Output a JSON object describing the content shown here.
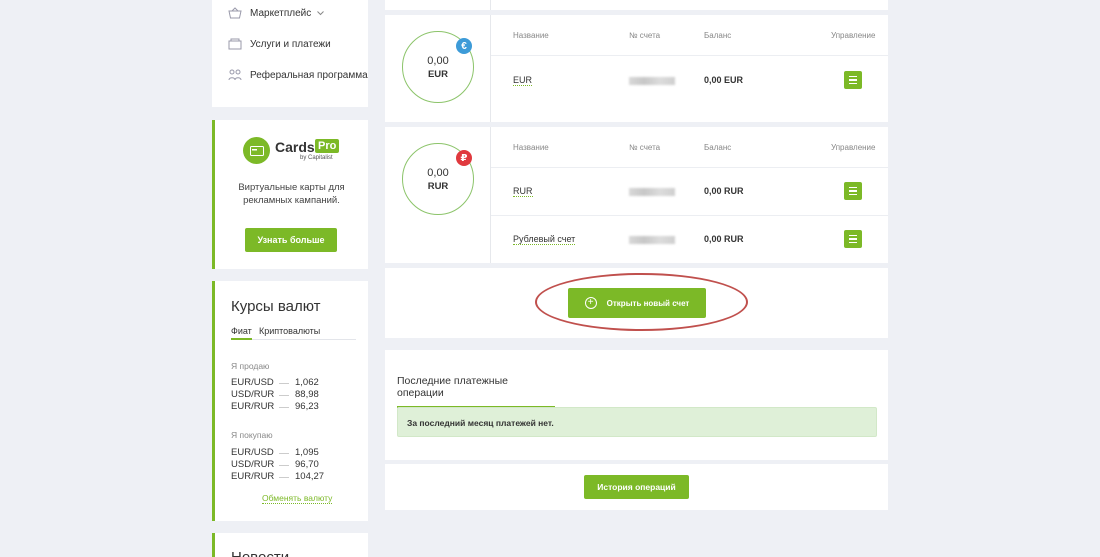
{
  "nav": {
    "items": [
      {
        "label": "Маркетплейс",
        "icon": "basket-icon",
        "has_chevron": true
      },
      {
        "label": "Услуги и платежи",
        "icon": "wallet-icon",
        "has_chevron": false
      },
      {
        "label": "Реферальная программа",
        "icon": "referral-icon",
        "has_chevron": false
      }
    ]
  },
  "promo": {
    "brand": "Cards",
    "brand_badge": "Pro",
    "by": "by Capitalist",
    "description_line1": "Виртуальные карты для",
    "description_line2": "рекламных кампаний.",
    "button": "Узнать больше"
  },
  "rates": {
    "title": "Курсы валют",
    "tabs": [
      "Фиат",
      "Криптовалюты"
    ],
    "sell_label": "Я продаю",
    "sell": [
      {
        "pair_from": "EUR",
        "pair_to": "USD",
        "value": "1,062"
      },
      {
        "pair_from": "USD",
        "pair_to": "RUR",
        "value": "88,98"
      },
      {
        "pair_from": "EUR",
        "pair_to": "RUR",
        "value": "96,23"
      }
    ],
    "buy_label": "Я покупаю",
    "buy": [
      {
        "pair_from": "EUR",
        "pair_to": "USD",
        "value": "1,095"
      },
      {
        "pair_from": "USD",
        "pair_to": "RUR",
        "value": "96,70"
      },
      {
        "pair_from": "EUR",
        "pair_to": "RUR",
        "value": "104,27"
      }
    ],
    "exchange_link": "Обменять валюту"
  },
  "news": {
    "title": "Новости"
  },
  "table_headers": {
    "name": "Название",
    "account": "№ счета",
    "balance": "Баланс",
    "manage": "Управление"
  },
  "accounts": [
    {
      "currency": "EUR",
      "total": "0,00",
      "symbol": "€",
      "badge_color": "#3d9bd8",
      "rows": [
        {
          "name": "EUR",
          "balance": "0,00 EUR"
        }
      ]
    },
    {
      "currency": "RUR",
      "total": "0,00",
      "symbol": "₽",
      "badge_color": "#e0393e",
      "rows": [
        {
          "name": "RUR",
          "balance": "0,00 RUR"
        },
        {
          "name": "Рублевый счет",
          "balance": "0,00 RUR"
        }
      ]
    }
  ],
  "open_account_button": "Открыть новый счет",
  "payments": {
    "tab": "Последние платежные операции",
    "empty_message": "За последний месяц платежей нет.",
    "history_button": "История операций"
  },
  "colors": {
    "accent": "#7cb927",
    "highlight": "#c0504d",
    "info_bg": "#dff0d8"
  }
}
